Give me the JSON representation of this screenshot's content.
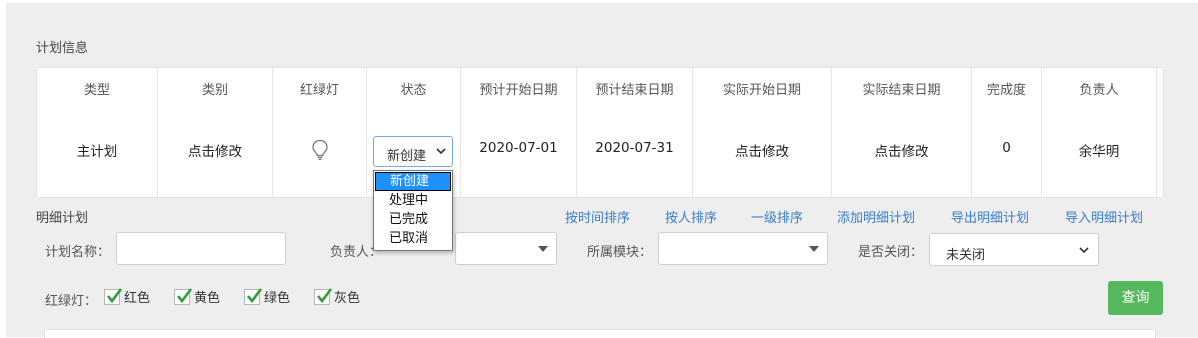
{
  "plan_info": {
    "title": "计划信息",
    "columns": [
      {
        "header": "类型",
        "value": "主计划"
      },
      {
        "header": "类别",
        "value": "点击修改"
      },
      {
        "header": "红绿灯",
        "value": ""
      },
      {
        "header": "状态",
        "value": "新创建"
      },
      {
        "header": "预计开始日期",
        "value": "2020-07-01"
      },
      {
        "header": "预计结束日期",
        "value": "2020-07-31"
      },
      {
        "header": "实际开始日期",
        "value": "点击修改"
      },
      {
        "header": "实际结束日期",
        "value": "点击修改"
      },
      {
        "header": "完成度",
        "value": "0"
      },
      {
        "header": "负责人",
        "value": "余华明"
      }
    ],
    "status_options": [
      "新创建",
      "处理中",
      "已完成",
      "已取消"
    ],
    "status_selected": "新创建"
  },
  "detail": {
    "title": "明细计划",
    "actions": [
      "按时间排序",
      "按人排序",
      "一级排序",
      "添加明细计划",
      "导出明细计划",
      "导入明细计划"
    ],
    "filters": {
      "plan_name_label": "计划名称：",
      "plan_name_value": "",
      "owner_label": "负责人：",
      "owner_value": "",
      "module_label": "所属模块：",
      "module_value": "",
      "closed_label": "是否关闭：",
      "closed_value": "未关闭"
    },
    "light_label": "红绿灯：",
    "light_options": [
      {
        "label": "红色",
        "checked": true
      },
      {
        "label": "黄色",
        "checked": true
      },
      {
        "label": "绿色",
        "checked": true
      },
      {
        "label": "灰色",
        "checked": true
      }
    ],
    "query_button": "查询"
  },
  "colors": {
    "panel_bg": "#eeeeee",
    "link": "#3a7ec6",
    "query_button": "#55b85c",
    "dropdown_selected": "#1e90ff",
    "check": "#2e9e3a"
  }
}
